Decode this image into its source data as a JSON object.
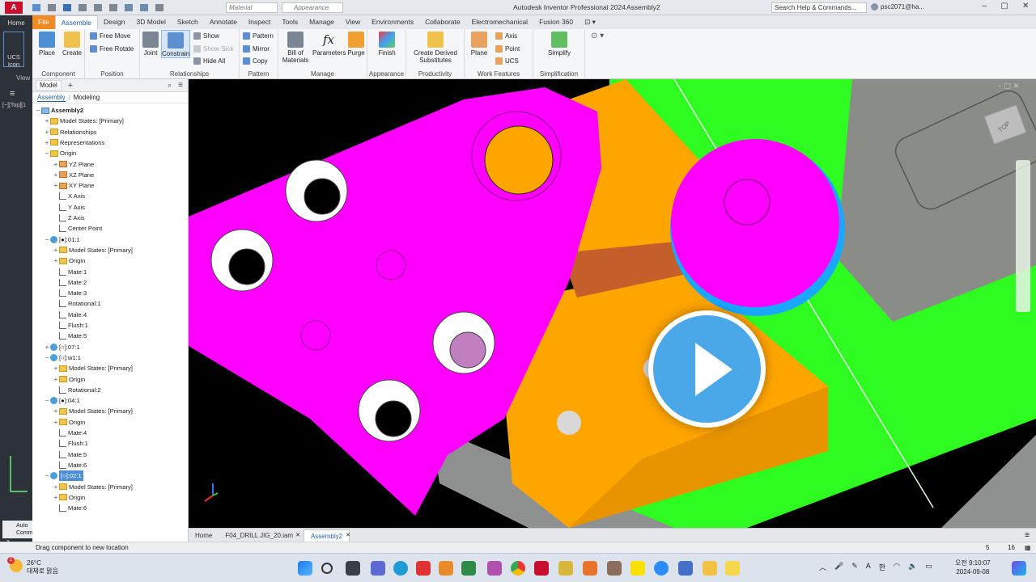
{
  "app": {
    "title": "Autodesk Inventor Professional 2024",
    "document": "Assembly2",
    "search_placeholder": "Search Help & Commands...",
    "user": "psc2071@ha...",
    "material": "Material",
    "appearance": "Appearance"
  },
  "tabs": [
    "File",
    "Assemble",
    "Design",
    "3D Model",
    "Sketch",
    "Annotate",
    "Inspect",
    "Tools",
    "Manage",
    "View",
    "Environments",
    "Collaborate",
    "Electromechanical",
    "Fusion 360"
  ],
  "left_strip": {
    "home": "Home",
    "ucs": "UCS Icon",
    "views": "View",
    "view_cube": "[−][Top][1"
  },
  "ribbon": {
    "component": {
      "label": "Component",
      "place": "Place",
      "create": "Create"
    },
    "position": {
      "label": "Position",
      "free_move": "Free Move",
      "free_rotate": "Free Rotate"
    },
    "relationships": {
      "label": "Relationships",
      "joint": "Joint",
      "constrain": "Constrain",
      "show": "Show",
      "show_sick": "Show Sick",
      "hide_all": "Hide All"
    },
    "pattern": {
      "label": "Pattern",
      "pattern": "Pattern",
      "mirror": "Mirror",
      "copy": "Copy"
    },
    "manage": {
      "label": "Manage",
      "bom": "Bill of Materials",
      "parameters": "Parameters",
      "purge": "Purge"
    },
    "appearance": {
      "label": "Appearance",
      "finish": "Finish"
    },
    "productivity": {
      "label": "Productivity",
      "derived": "Create Derived Substitutes"
    },
    "work": {
      "label": "Work Features",
      "plane": "Plane",
      "axis": "Axis",
      "point": "Point",
      "ucs": "UCS"
    },
    "simplification": {
      "label": "Simplification",
      "simplify": "Simplify"
    }
  },
  "browser": {
    "tab": "Model",
    "sub_assembly": "Assembly",
    "sub_modeling": "Modeling",
    "rows": [
      {
        "text": "Assembly2",
        "icon": "asm",
        "indent": 0,
        "exp": "−",
        "bold": true
      },
      {
        "text": "Model States: [Primary]",
        "icon": "fold",
        "indent": 1,
        "exp": "+"
      },
      {
        "text": "Relationships",
        "icon": "fold",
        "indent": 1,
        "exp": "+"
      },
      {
        "text": "Representations",
        "icon": "fold",
        "indent": 1,
        "exp": "+"
      },
      {
        "text": "Origin",
        "icon": "fold",
        "indent": 1,
        "exp": "−"
      },
      {
        "text": "YZ Plane",
        "icon": "plane",
        "indent": 2,
        "exp": "+"
      },
      {
        "text": "XZ Plane",
        "icon": "plane",
        "indent": 2,
        "exp": "+"
      },
      {
        "text": "XY Plane",
        "icon": "plane",
        "indent": 2,
        "exp": "+"
      },
      {
        "text": "X Axis",
        "icon": "mate",
        "indent": 2,
        "exp": ""
      },
      {
        "text": "Y Axis",
        "icon": "mate",
        "indent": 2,
        "exp": ""
      },
      {
        "text": "Z Axis",
        "icon": "mate",
        "indent": 2,
        "exp": ""
      },
      {
        "text": "Center Point",
        "icon": "mate",
        "indent": 2,
        "exp": ""
      },
      {
        "text": "[●]:01:1",
        "icon": "part",
        "indent": 1,
        "exp": "−"
      },
      {
        "text": "Model States: [Primary]",
        "icon": "fold",
        "indent": 2,
        "exp": "+"
      },
      {
        "text": "Origin",
        "icon": "fold",
        "indent": 2,
        "exp": "+"
      },
      {
        "text": "Mate:1",
        "icon": "mate",
        "indent": 2,
        "exp": ""
      },
      {
        "text": "Mate:2",
        "icon": "mate",
        "indent": 2,
        "exp": ""
      },
      {
        "text": "Mate:3",
        "icon": "mate",
        "indent": 2,
        "exp": ""
      },
      {
        "text": "Rotational:1",
        "icon": "mate",
        "indent": 2,
        "exp": ""
      },
      {
        "text": "Mate:4",
        "icon": "mate",
        "indent": 2,
        "exp": ""
      },
      {
        "text": "Flush:1",
        "icon": "mate",
        "indent": 2,
        "exp": ""
      },
      {
        "text": "Mate:5",
        "icon": "mate",
        "indent": 2,
        "exp": ""
      },
      {
        "text": "[○]:07:1",
        "icon": "part",
        "indent": 1,
        "exp": "+"
      },
      {
        "text": "[○]:w1:1",
        "icon": "part",
        "indent": 1,
        "exp": "−"
      },
      {
        "text": "Model States: [Primary]",
        "icon": "fold",
        "indent": 2,
        "exp": "+"
      },
      {
        "text": "Origin",
        "icon": "fold",
        "indent": 2,
        "exp": "+"
      },
      {
        "text": "Rotational:2",
        "icon": "mate",
        "indent": 2,
        "exp": ""
      },
      {
        "text": "[●]:04:1",
        "icon": "part",
        "indent": 1,
        "exp": "−"
      },
      {
        "text": "Model States: [Primary]",
        "icon": "fold",
        "indent": 2,
        "exp": "+"
      },
      {
        "text": "Origin",
        "icon": "fold",
        "indent": 2,
        "exp": "+"
      },
      {
        "text": "Mate:4",
        "icon": "mate",
        "indent": 2,
        "exp": ""
      },
      {
        "text": "Flush:1",
        "icon": "mate",
        "indent": 2,
        "exp": ""
      },
      {
        "text": "Mate:5",
        "icon": "mate",
        "indent": 2,
        "exp": ""
      },
      {
        "text": "Mate:6",
        "icon": "mate",
        "indent": 2,
        "exp": ""
      },
      {
        "text": "[○]:02:1",
        "icon": "part",
        "indent": 1,
        "exp": "−",
        "selected": true
      },
      {
        "text": "Model States: [Primary]",
        "icon": "fold",
        "indent": 2,
        "exp": "+"
      },
      {
        "text": "Origin",
        "icon": "fold",
        "indent": 2,
        "exp": "+"
      },
      {
        "text": "Mate:6",
        "icon": "mate",
        "indent": 2,
        "exp": ""
      }
    ]
  },
  "doc_tabs": [
    "Home",
    "F04_DRILL JIG_20.iam",
    "Assembly2"
  ],
  "status": {
    "message": "Drag component to new location",
    "n1": "5",
    "n2": "16"
  },
  "auto_panel": {
    "line1": "Auto",
    "line2": "Comm"
  },
  "taskbar": {
    "weather_temp": "26°C",
    "weather_text": "대체로 맑음",
    "time": "오전 9:10:07",
    "date": "2024-09-08",
    "ime": "한",
    "lang": "A",
    "badge": "1"
  },
  "colors": {
    "magenta": "#ff00ff",
    "orange": "#ffa500",
    "green": "#2efc21",
    "accent": "#1f5fa8"
  },
  "viewcube_label": "TOP"
}
